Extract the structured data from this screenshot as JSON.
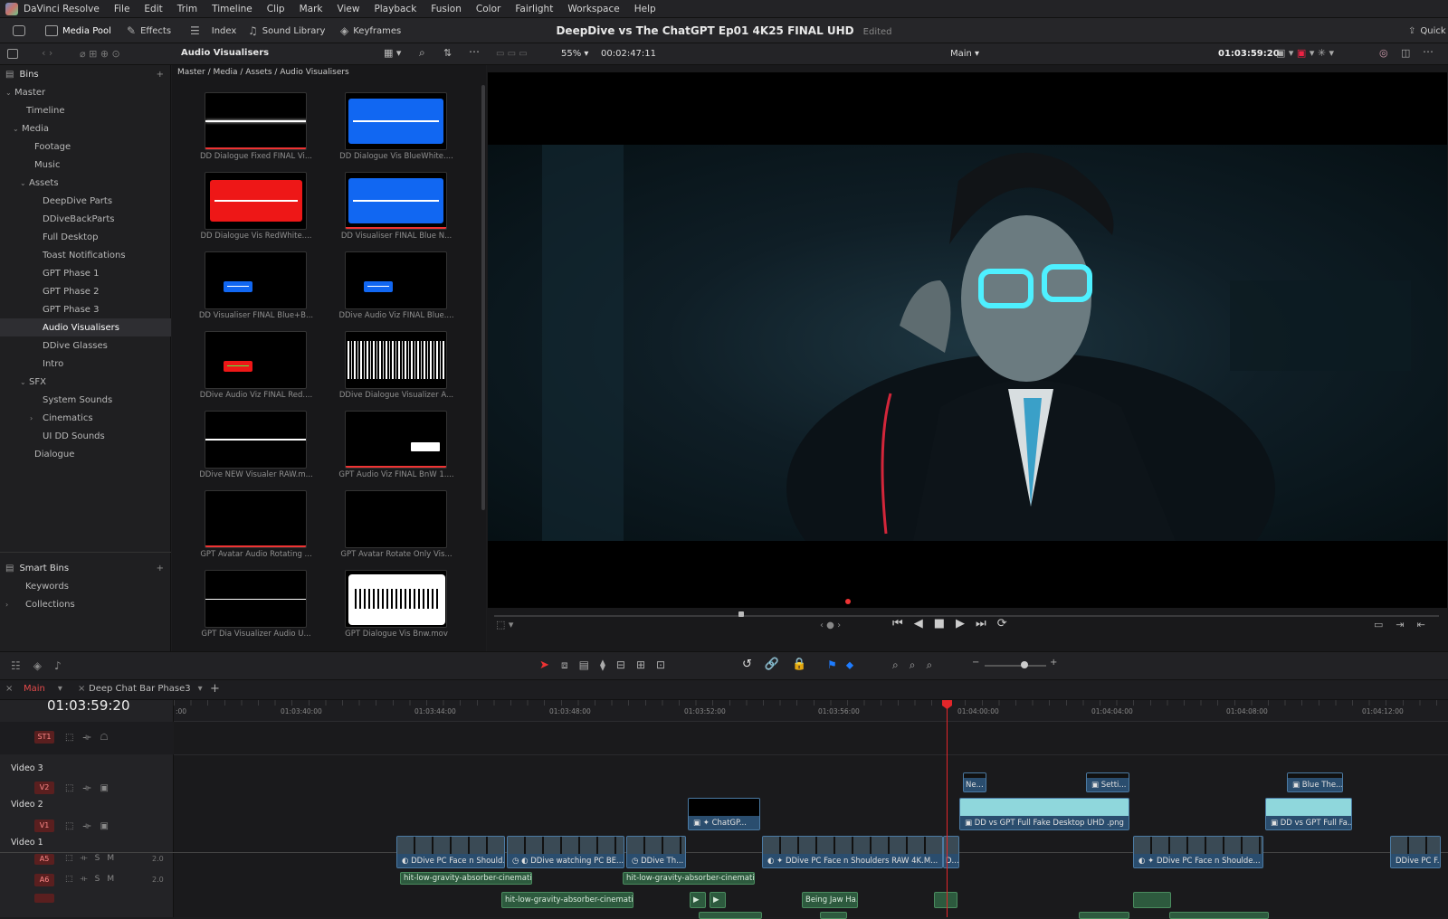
{
  "app": {
    "name": "DaVinci Resolve",
    "menu": [
      "File",
      "Edit",
      "Trim",
      "Timeline",
      "Clip",
      "Mark",
      "View",
      "Playback",
      "Fusion",
      "Color",
      "Fairlight",
      "Workspace",
      "Help"
    ]
  },
  "toolbar": {
    "media_pool": "Media Pool",
    "effects": "Effects",
    "index": "Index",
    "sound_library": "Sound Library",
    "keyframes": "Keyframes",
    "project_title": "DeepDive vs The ChatGPT Ep01 4K25 FINAL UHD",
    "edited": "Edited",
    "quick_export": "Quick"
  },
  "pool_header": {
    "title": "Audio Visualisers",
    "bins_label": "Bins",
    "breadcrumb": "Master / Media / Assets / Audio Visualisers"
  },
  "viewer_header": {
    "zoom": "55%",
    "duration": "00:02:47:11",
    "timeline_name": "Main",
    "timecode": "01:03:59:20"
  },
  "bins": [
    {
      "label": "Master",
      "expanded": true
    },
    {
      "label": "Timeline"
    },
    {
      "label": "Media",
      "expanded": true
    },
    {
      "label": "Footage"
    },
    {
      "label": "Music"
    },
    {
      "label": "Assets",
      "expanded": true
    },
    {
      "label": "DeepDive Parts"
    },
    {
      "label": "DDiveBackParts"
    },
    {
      "label": "Full Desktop"
    },
    {
      "label": "Toast Notifications"
    },
    {
      "label": "GPT Phase 1"
    },
    {
      "label": "GPT Phase 2"
    },
    {
      "label": "GPT Phase 3"
    },
    {
      "label": "Audio Visualisers",
      "selected": true
    },
    {
      "label": "DDive Glasses"
    },
    {
      "label": "Intro"
    },
    {
      "label": "SFX",
      "expanded": true
    },
    {
      "label": "System Sounds"
    },
    {
      "label": "Cinematics",
      "collapsed": true
    },
    {
      "label": "UI DD Sounds"
    },
    {
      "label": "Dialogue"
    }
  ],
  "smart_bins": {
    "title": "Smart Bins",
    "items": [
      "Keywords",
      "Collections"
    ]
  },
  "clips": [
    {
      "label": "DD Dialogue Fixed FINAL Vi...",
      "style": "white-wave-black"
    },
    {
      "label": "DD Dialogue Vis BlueWhite....",
      "style": "blue-box"
    },
    {
      "label": "DD Dialogue Vis RedWhite....",
      "style": "red-box"
    },
    {
      "label": "DD Visualiser FINAL Blue N...",
      "style": "blue-box"
    },
    {
      "label": "DD Visualiser FINAL Blue+B...",
      "style": "small-blue"
    },
    {
      "label": "DDive Audio Viz FINAL Blue....",
      "style": "small-blue"
    },
    {
      "label": "DDive Audio Viz FINAL Red....",
      "style": "small-red"
    },
    {
      "label": "DDive Dialogue Visualizer A...",
      "style": "white-noise"
    },
    {
      "label": "DDive NEW Visualer RAW.m...",
      "style": "white-line"
    },
    {
      "label": "GPT Audio Viz FINAL BnW 1....",
      "style": "small-white"
    },
    {
      "label": "GPT Avatar Audio Rotating ...",
      "style": "black-red-line"
    },
    {
      "label": "GPT Avatar Rotate Only Vis...",
      "style": "black"
    },
    {
      "label": "GPT Dia Visualizer Audio U...",
      "style": "thin-line"
    },
    {
      "label": "GPT Dialogue Vis Bnw.mov",
      "style": "white-box-wave"
    }
  ],
  "timeline": {
    "tab_main": "Main",
    "tab_other": "Deep Chat Bar Phase3",
    "timecode": "01:03:59:20",
    "ruler": [
      ":00",
      "01:03:40:00",
      "01:03:44:00",
      "01:03:48:00",
      "01:03:52:00",
      "01:03:56:00",
      "01:04:00:00",
      "01:04:04:00",
      "01:04:08:00",
      "01:04:12:00"
    ],
    "tracks": {
      "st1": "ST1",
      "video3": "Video 3",
      "v2": "V2",
      "video2": "Video 2",
      "v1": "V1",
      "video1": "Video 1",
      "a5": "A5",
      "a6": "A6",
      "a_level": "2.0",
      "s": "S",
      "m": "M"
    },
    "v3_clips": [
      "Ne...",
      "Setti...",
      "Blue The..."
    ],
    "v2_clips": [
      "ChatGP...",
      "DD vs GPT Full Fake Desktop UHD .png",
      "DD vs GPT Full Fa..."
    ],
    "v1_clips": [
      "DDive PC Face n Should...",
      "DDive watching PC BE...",
      "DDive Th...",
      "DDive PC Face n Shoulders RAW 4K.M...",
      "D...",
      "DDive PC Face n Shoulde...",
      "DDive PC F..."
    ],
    "a5_clips": [
      "hit-low-gravity-absorber-cinematic-t...",
      "hit-low-gravity-absorber-cinematic-t..."
    ],
    "a6_clips": [
      "hit-low-gravity-absorber-cinematic-t...",
      "Being Jaw Ha..."
    ]
  }
}
